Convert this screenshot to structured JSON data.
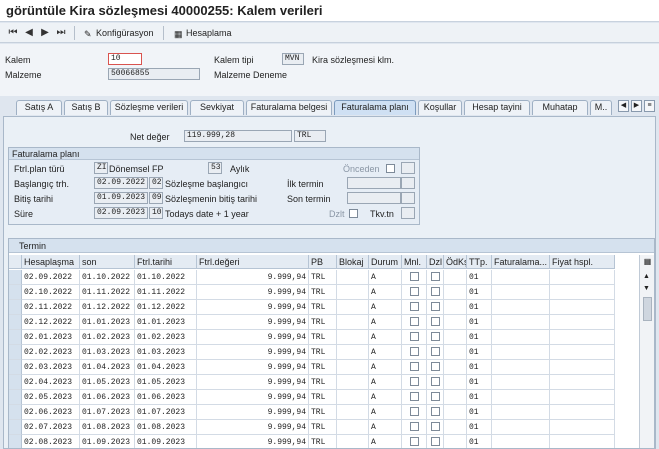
{
  "title": "görüntüle Kira sözleşmesi 40000255: Kalem verileri",
  "toolbar": {
    "konfig": "Konfigürasyon",
    "hesap": "Hesaplama"
  },
  "header": {
    "kalem_label": "Kalem",
    "kalem_value": "10",
    "malzeme_label": "Malzeme",
    "malzeme_value": "50066855",
    "kalem_tipi_label": "Kalem tipi",
    "kalem_tipi_value": "MVN",
    "kalem_tipi_desc": "Kira sözleşmesi klm.",
    "malzeme_desc": "Malzeme Deneme"
  },
  "tabs": [
    "Satış A",
    "Satış B",
    "Sözleşme verileri",
    "Sevkiyat",
    "Faturalama belgesi",
    "Faturalama planı",
    "Koşullar",
    "Hesap tayini",
    "Muhatap",
    "M.."
  ],
  "active_tab": "Faturalama planı",
  "net": {
    "label": "Net değer",
    "value": "119.999,28",
    "currency": "TRL"
  },
  "plan": {
    "group_title": "Faturalama planı",
    "type_label": "Ftrl.plan türü",
    "type_code": "ZI",
    "type_text": "Dönemsel FP",
    "freq_code": "53",
    "freq_text": "Aylık",
    "onceden": "Önceden",
    "start_label": "Başlangıç trh.",
    "start_value": "02.09.2022",
    "start_rule": "02",
    "start_rule_text": "Sözleşme başlangıcı",
    "end_label": "Bitiş tarihi",
    "end_value": "01.09.2023",
    "end_rule": "09",
    "end_rule_text": "Sözleşmenin bitiş tarihi",
    "sure_label": "Süre",
    "sure_value": "02.09.2023",
    "sure_rule": "10",
    "sure_rule_text": "Todays date + 1 year",
    "ilk_label": "İlk termin",
    "son_label": "Son termin",
    "dzlt": "Dzlt",
    "tkvtn": "Tkv.tn"
  },
  "table": {
    "title": "Termin",
    "columns": [
      "Hesaplaşma",
      "son",
      "Ftrl.tarihi",
      "Ftrl.değeri",
      "PB",
      "Blokaj",
      "Durum",
      "Mnl.",
      "Dzl",
      "ÖdKş",
      "TTp.",
      "Faturalama...",
      "Fiyat hspl."
    ],
    "rows": [
      [
        "02.09.2022",
        "01.10.2022",
        "01.10.2022",
        "9.999,94",
        "TRL",
        "",
        "A",
        "",
        "",
        "",
        "01",
        "",
        ""
      ],
      [
        "02.10.2022",
        "01.11.2022",
        "01.11.2022",
        "9.999,94",
        "TRL",
        "",
        "A",
        "",
        "",
        "",
        "01",
        "",
        ""
      ],
      [
        "02.11.2022",
        "01.12.2022",
        "01.12.2022",
        "9.999,94",
        "TRL",
        "",
        "A",
        "",
        "",
        "",
        "01",
        "",
        ""
      ],
      [
        "02.12.2022",
        "01.01.2023",
        "01.01.2023",
        "9.999,94",
        "TRL",
        "",
        "A",
        "",
        "",
        "",
        "01",
        "",
        ""
      ],
      [
        "02.01.2023",
        "01.02.2023",
        "01.02.2023",
        "9.999,94",
        "TRL",
        "",
        "A",
        "",
        "",
        "",
        "01",
        "",
        ""
      ],
      [
        "02.02.2023",
        "01.03.2023",
        "01.03.2023",
        "9.999,94",
        "TRL",
        "",
        "A",
        "",
        "",
        "",
        "01",
        "",
        ""
      ],
      [
        "02.03.2023",
        "01.04.2023",
        "01.04.2023",
        "9.999,94",
        "TRL",
        "",
        "A",
        "",
        "",
        "",
        "01",
        "",
        ""
      ],
      [
        "02.04.2023",
        "01.05.2023",
        "01.05.2023",
        "9.999,94",
        "TRL",
        "",
        "A",
        "",
        "",
        "",
        "01",
        "",
        ""
      ],
      [
        "02.05.2023",
        "01.06.2023",
        "01.06.2023",
        "9.999,94",
        "TRL",
        "",
        "A",
        "",
        "",
        "",
        "01",
        "",
        ""
      ],
      [
        "02.06.2023",
        "01.07.2023",
        "01.07.2023",
        "9.999,94",
        "TRL",
        "",
        "A",
        "",
        "",
        "",
        "01",
        "",
        ""
      ],
      [
        "02.07.2023",
        "01.08.2023",
        "01.08.2023",
        "9.999,94",
        "TRL",
        "",
        "A",
        "",
        "",
        "",
        "01",
        "",
        ""
      ],
      [
        "02.08.2023",
        "01.09.2023",
        "01.09.2023",
        "9.999,94",
        "TRL",
        "",
        "A",
        "",
        "",
        "",
        "01",
        "",
        ""
      ]
    ]
  }
}
